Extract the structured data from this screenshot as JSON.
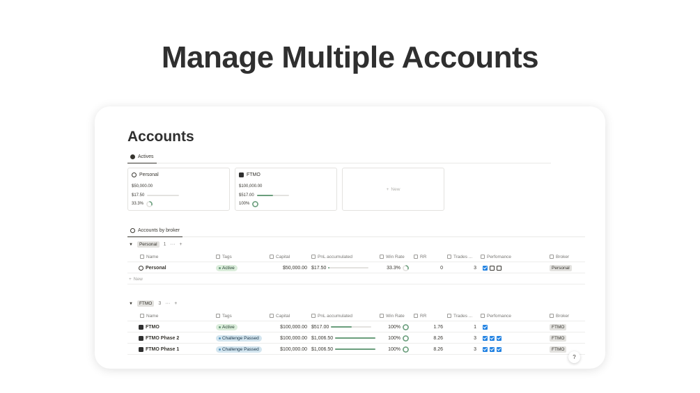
{
  "hero": {
    "title": "Manage Multiple Accounts"
  },
  "page": {
    "title": "Accounts"
  },
  "gallery_tab": {
    "label": "Actives"
  },
  "gallery": [
    {
      "name": "Personal",
      "capital": "$50,000.00",
      "pnl": "$17.50",
      "win_rate": "33.3%",
      "pnl_fill": 0.0,
      "win_fill": 0.333,
      "icon": "person-icon"
    },
    {
      "name": "FTMO",
      "capital": "$100,000.00",
      "pnl": "$517.00",
      "win_rate": "100%",
      "pnl_fill": 0.51,
      "win_fill": 1.0,
      "icon": "ftmo-logo-icon"
    }
  ],
  "gallery_new": {
    "label": "New"
  },
  "table_tab": {
    "label": "Accounts by broker"
  },
  "columns": {
    "name": "Name",
    "tags": "Tags",
    "capital": "Capital",
    "pnl": "PnL accumulated",
    "win_rate": "Win Rate",
    "rr": "RR",
    "trades": "Trades ...",
    "performance": "Perfomance",
    "broker": "Broker"
  },
  "groups": [
    {
      "label": "Personal",
      "count": "1",
      "rows": [
        {
          "name": "Personal",
          "tag": "Active",
          "capital": "$50,000.00",
          "pnl": "$17.50",
          "pnl_fill": 0.02,
          "win_rate": "33.3%",
          "win_fill": 0.333,
          "rr": "0",
          "trades": "3",
          "perf": [
            true,
            false,
            false
          ],
          "broker": "Personal"
        }
      ],
      "new_label": "New"
    },
    {
      "label": "FTMO",
      "count": "3",
      "rows": [
        {
          "name": "FTMO",
          "tag": "Active",
          "capital": "$100,000.00",
          "pnl": "$517.00",
          "pnl_fill": 0.51,
          "win_rate": "100%",
          "win_fill": 1.0,
          "rr": "1.76",
          "trades": "1",
          "perf": [
            true
          ],
          "broker": "FTMO"
        },
        {
          "name": "FTMO Phase 2",
          "tag": "Challenge Passed",
          "capital": "$100,000.00",
          "pnl": "$1,006.50",
          "pnl_fill": 1.0,
          "win_rate": "100%",
          "win_fill": 1.0,
          "rr": "8.26",
          "trades": "3",
          "perf": [
            true,
            true,
            true
          ],
          "broker": "FTMO"
        },
        {
          "name": "FTMO Phase 1",
          "tag": "Challenge Passed",
          "capital": "$100,000.00",
          "pnl": "$1,006.50",
          "pnl_fill": 1.0,
          "win_rate": "100%",
          "win_fill": 1.0,
          "rr": "8.26",
          "trades": "3",
          "perf": [
            true,
            true,
            true
          ],
          "broker": "FTMO"
        }
      ]
    }
  ],
  "colors": {
    "active_bg": "#dbeddb",
    "active_fg": "#1c3829",
    "active_dot": "#6c9b7d",
    "passed_bg": "#d3e5ef",
    "passed_fg": "#183347",
    "passed_dot": "#5b97bd",
    "check": "#2383e2",
    "progress": "#6a9e7c"
  },
  "help": {
    "label": "?"
  }
}
